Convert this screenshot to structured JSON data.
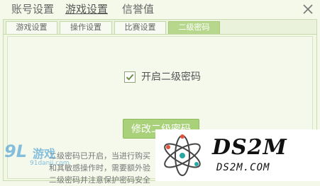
{
  "top_tabs": [
    {
      "label": "账号设置"
    },
    {
      "label": "游戏设置",
      "active": true
    },
    {
      "label": "信誉值"
    }
  ],
  "sub_tabs": [
    {
      "label": "游戏设置"
    },
    {
      "label": "操作设置"
    },
    {
      "label": "比赛设置"
    },
    {
      "label": "二级密码",
      "active": true
    }
  ],
  "security": {
    "enable_checkbox_checked": true,
    "enable_label": "开启二级密码",
    "change_button": "修改二级密码",
    "info_lines": [
      "二级密码已开启，当进行购买",
      "和其敏感操作时，需要额外验",
      "二级密码并注意保护密码安全"
    ]
  },
  "watermarks": {
    "left_logo": "9L",
    "left_text": "游戏",
    "left_url": "91danji.com",
    "right_brand": "DS2M",
    "right_url": "DS2M.COM"
  },
  "colors": {
    "accent_green": "#a8d17a",
    "active_subtab": "#b7d88c",
    "background": "#f3f8e8"
  },
  "icons": {
    "close": "close-icon",
    "check": "check-icon",
    "atom": "atom-logo-icon"
  }
}
